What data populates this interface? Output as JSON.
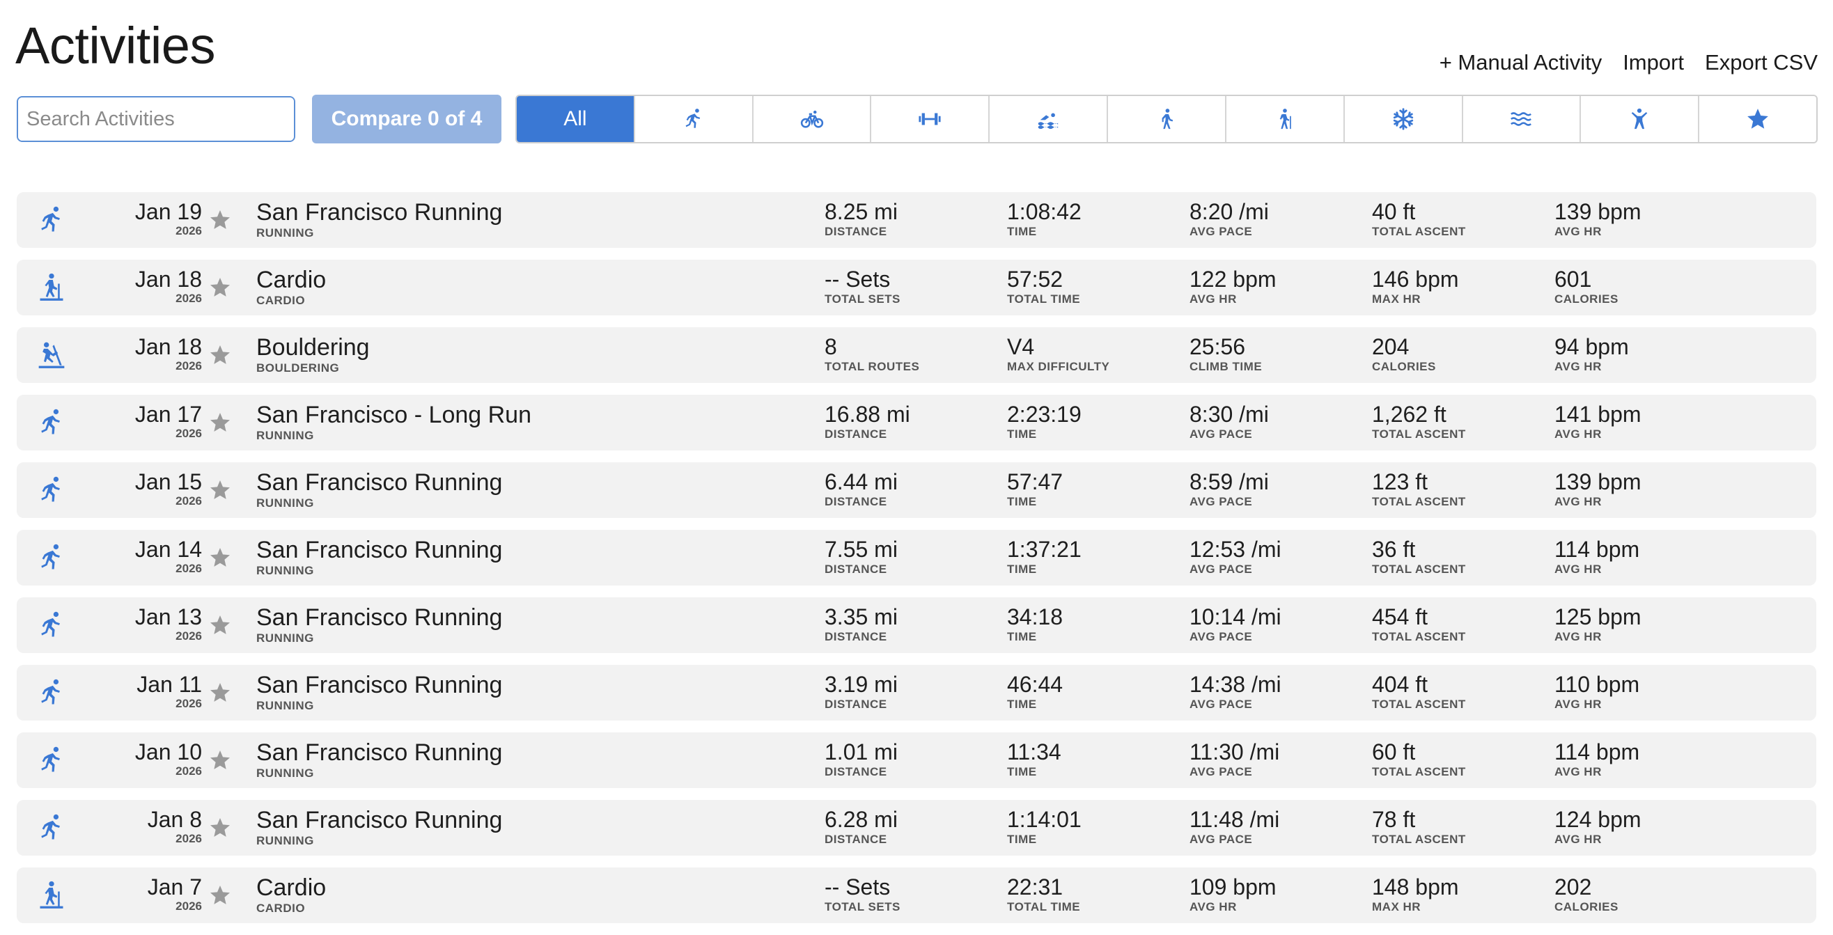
{
  "page": {
    "title": "Activities"
  },
  "top_actions": {
    "manual_activity": "+ Manual Activity",
    "import": "Import",
    "export_csv": "Export CSV"
  },
  "toolbar": {
    "search_placeholder": "Search Activities",
    "search_icon": "search-icon",
    "compare_label": "Compare 0 of 4"
  },
  "filters": [
    {
      "label": "All",
      "icon": "all",
      "active": true
    },
    {
      "label": "",
      "icon": "running-icon",
      "active": false
    },
    {
      "label": "",
      "icon": "cycling-icon",
      "active": false
    },
    {
      "label": "",
      "icon": "strength-icon",
      "active": false
    },
    {
      "label": "",
      "icon": "swimming-icon",
      "active": false
    },
    {
      "label": "",
      "icon": "walking-icon",
      "active": false
    },
    {
      "label": "",
      "icon": "hiking-icon",
      "active": false
    },
    {
      "label": "",
      "icon": "snowflake-icon",
      "active": false
    },
    {
      "label": "",
      "icon": "water-icon",
      "active": false
    },
    {
      "label": "",
      "icon": "other-activity-icon",
      "active": false
    },
    {
      "label": "",
      "icon": "favorites-star-icon",
      "active": false
    }
  ],
  "colors": {
    "accent": "#3a78d4",
    "compare_disabled": "#94b3e1",
    "row_bg": "#f2f2f2",
    "star_inactive": "#9a9a9a"
  },
  "activities": [
    {
      "icon": "running-icon",
      "date": "Jan 19",
      "year": "2026",
      "title": "San Francisco Running",
      "type": "RUNNING",
      "metrics": [
        {
          "value": "8.25 mi",
          "label": "DISTANCE"
        },
        {
          "value": "1:08:42",
          "label": "TIME"
        },
        {
          "value": "8:20 /mi",
          "label": "AVG PACE"
        },
        {
          "value": "40 ft",
          "label": "TOTAL ASCENT"
        },
        {
          "value": "139 bpm",
          "label": "AVG HR"
        }
      ]
    },
    {
      "icon": "cardio-icon",
      "date": "Jan 18",
      "year": "2026",
      "title": "Cardio",
      "type": "CARDIO",
      "metrics": [
        {
          "value": "-- Sets",
          "label": "TOTAL SETS"
        },
        {
          "value": "57:52",
          "label": "TOTAL TIME"
        },
        {
          "value": "122 bpm",
          "label": "AVG HR"
        },
        {
          "value": "146 bpm",
          "label": "MAX HR"
        },
        {
          "value": "601",
          "label": "CALORIES"
        }
      ]
    },
    {
      "icon": "bouldering-icon",
      "date": "Jan 18",
      "year": "2026",
      "title": "Bouldering",
      "type": "BOULDERING",
      "metrics": [
        {
          "value": "8",
          "label": "TOTAL ROUTES"
        },
        {
          "value": "V4",
          "label": "MAX DIFFICULTY"
        },
        {
          "value": "25:56",
          "label": "CLIMB TIME"
        },
        {
          "value": "204",
          "label": "CALORIES"
        },
        {
          "value": "94 bpm",
          "label": "AVG HR"
        }
      ]
    },
    {
      "icon": "running-icon",
      "date": "Jan 17",
      "year": "2026",
      "title": "San Francisco - Long Run",
      "type": "RUNNING",
      "metrics": [
        {
          "value": "16.88 mi",
          "label": "DISTANCE"
        },
        {
          "value": "2:23:19",
          "label": "TIME"
        },
        {
          "value": "8:30 /mi",
          "label": "AVG PACE"
        },
        {
          "value": "1,262 ft",
          "label": "TOTAL ASCENT"
        },
        {
          "value": "141 bpm",
          "label": "AVG HR"
        }
      ]
    },
    {
      "icon": "running-icon",
      "date": "Jan 15",
      "year": "2026",
      "title": "San Francisco Running",
      "type": "RUNNING",
      "metrics": [
        {
          "value": "6.44 mi",
          "label": "DISTANCE"
        },
        {
          "value": "57:47",
          "label": "TIME"
        },
        {
          "value": "8:59 /mi",
          "label": "AVG PACE"
        },
        {
          "value": "123 ft",
          "label": "TOTAL ASCENT"
        },
        {
          "value": "139 bpm",
          "label": "AVG HR"
        }
      ]
    },
    {
      "icon": "running-icon",
      "date": "Jan 14",
      "year": "2026",
      "title": "San Francisco Running",
      "type": "RUNNING",
      "metrics": [
        {
          "value": "7.55 mi",
          "label": "DISTANCE"
        },
        {
          "value": "1:37:21",
          "label": "TIME"
        },
        {
          "value": "12:53 /mi",
          "label": "AVG PACE"
        },
        {
          "value": "36 ft",
          "label": "TOTAL ASCENT"
        },
        {
          "value": "114 bpm",
          "label": "AVG HR"
        }
      ]
    },
    {
      "icon": "running-icon",
      "date": "Jan 13",
      "year": "2026",
      "title": "San Francisco Running",
      "type": "RUNNING",
      "metrics": [
        {
          "value": "3.35 mi",
          "label": "DISTANCE"
        },
        {
          "value": "34:18",
          "label": "TIME"
        },
        {
          "value": "10:14 /mi",
          "label": "AVG PACE"
        },
        {
          "value": "454 ft",
          "label": "TOTAL ASCENT"
        },
        {
          "value": "125 bpm",
          "label": "AVG HR"
        }
      ]
    },
    {
      "icon": "running-icon",
      "date": "Jan 11",
      "year": "2026",
      "title": "San Francisco Running",
      "type": "RUNNING",
      "metrics": [
        {
          "value": "3.19 mi",
          "label": "DISTANCE"
        },
        {
          "value": "46:44",
          "label": "TIME"
        },
        {
          "value": "14:38 /mi",
          "label": "AVG PACE"
        },
        {
          "value": "404 ft",
          "label": "TOTAL ASCENT"
        },
        {
          "value": "110 bpm",
          "label": "AVG HR"
        }
      ]
    },
    {
      "icon": "running-icon",
      "date": "Jan 10",
      "year": "2026",
      "title": "San Francisco Running",
      "type": "RUNNING",
      "metrics": [
        {
          "value": "1.01 mi",
          "label": "DISTANCE"
        },
        {
          "value": "11:34",
          "label": "TIME"
        },
        {
          "value": "11:30 /mi",
          "label": "AVG PACE"
        },
        {
          "value": "60 ft",
          "label": "TOTAL ASCENT"
        },
        {
          "value": "114 bpm",
          "label": "AVG HR"
        }
      ]
    },
    {
      "icon": "running-icon",
      "date": "Jan 8",
      "year": "2026",
      "title": "San Francisco Running",
      "type": "RUNNING",
      "metrics": [
        {
          "value": "6.28 mi",
          "label": "DISTANCE"
        },
        {
          "value": "1:14:01",
          "label": "TIME"
        },
        {
          "value": "11:48 /mi",
          "label": "AVG PACE"
        },
        {
          "value": "78 ft",
          "label": "TOTAL ASCENT"
        },
        {
          "value": "124 bpm",
          "label": "AVG HR"
        }
      ]
    },
    {
      "icon": "cardio-icon",
      "date": "Jan 7",
      "year": "2026",
      "title": "Cardio",
      "type": "CARDIO",
      "metrics": [
        {
          "value": "-- Sets",
          "label": "TOTAL SETS"
        },
        {
          "value": "22:31",
          "label": "TOTAL TIME"
        },
        {
          "value": "109 bpm",
          "label": "AVG HR"
        },
        {
          "value": "148 bpm",
          "label": "MAX HR"
        },
        {
          "value": "202",
          "label": "CALORIES"
        }
      ]
    }
  ]
}
